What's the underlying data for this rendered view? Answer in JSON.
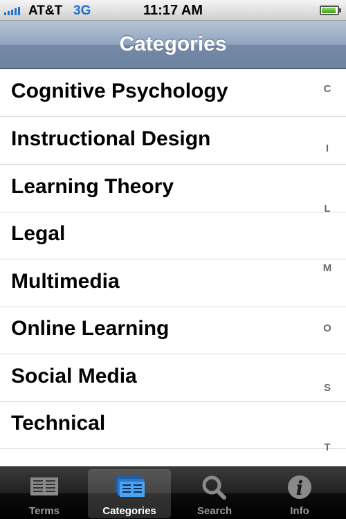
{
  "status_bar": {
    "carrier": "AT&T",
    "network": "3G",
    "time": "11:17 AM"
  },
  "nav_bar": {
    "title": "Categories"
  },
  "categories": [
    "Cognitive Psychology",
    "Instructional Design",
    "Learning Theory",
    "Legal",
    "Multimedia",
    "Online Learning",
    "Social Media",
    "Technical"
  ],
  "section_index": [
    "C",
    "I",
    "L",
    "M",
    "O",
    "S",
    "T"
  ],
  "tab_bar": {
    "tabs": [
      {
        "label": "Terms",
        "icon": "terms-icon",
        "selected": false
      },
      {
        "label": "Categories",
        "icon": "categories-icon",
        "selected": true
      },
      {
        "label": "Search",
        "icon": "search-icon",
        "selected": false
      },
      {
        "label": "Info",
        "icon": "info-icon",
        "selected": false
      }
    ]
  },
  "colors": {
    "status_accent": "#1f6fd0",
    "nav_bar": "#7489a6",
    "selected_icon": "#3f8fe0"
  }
}
